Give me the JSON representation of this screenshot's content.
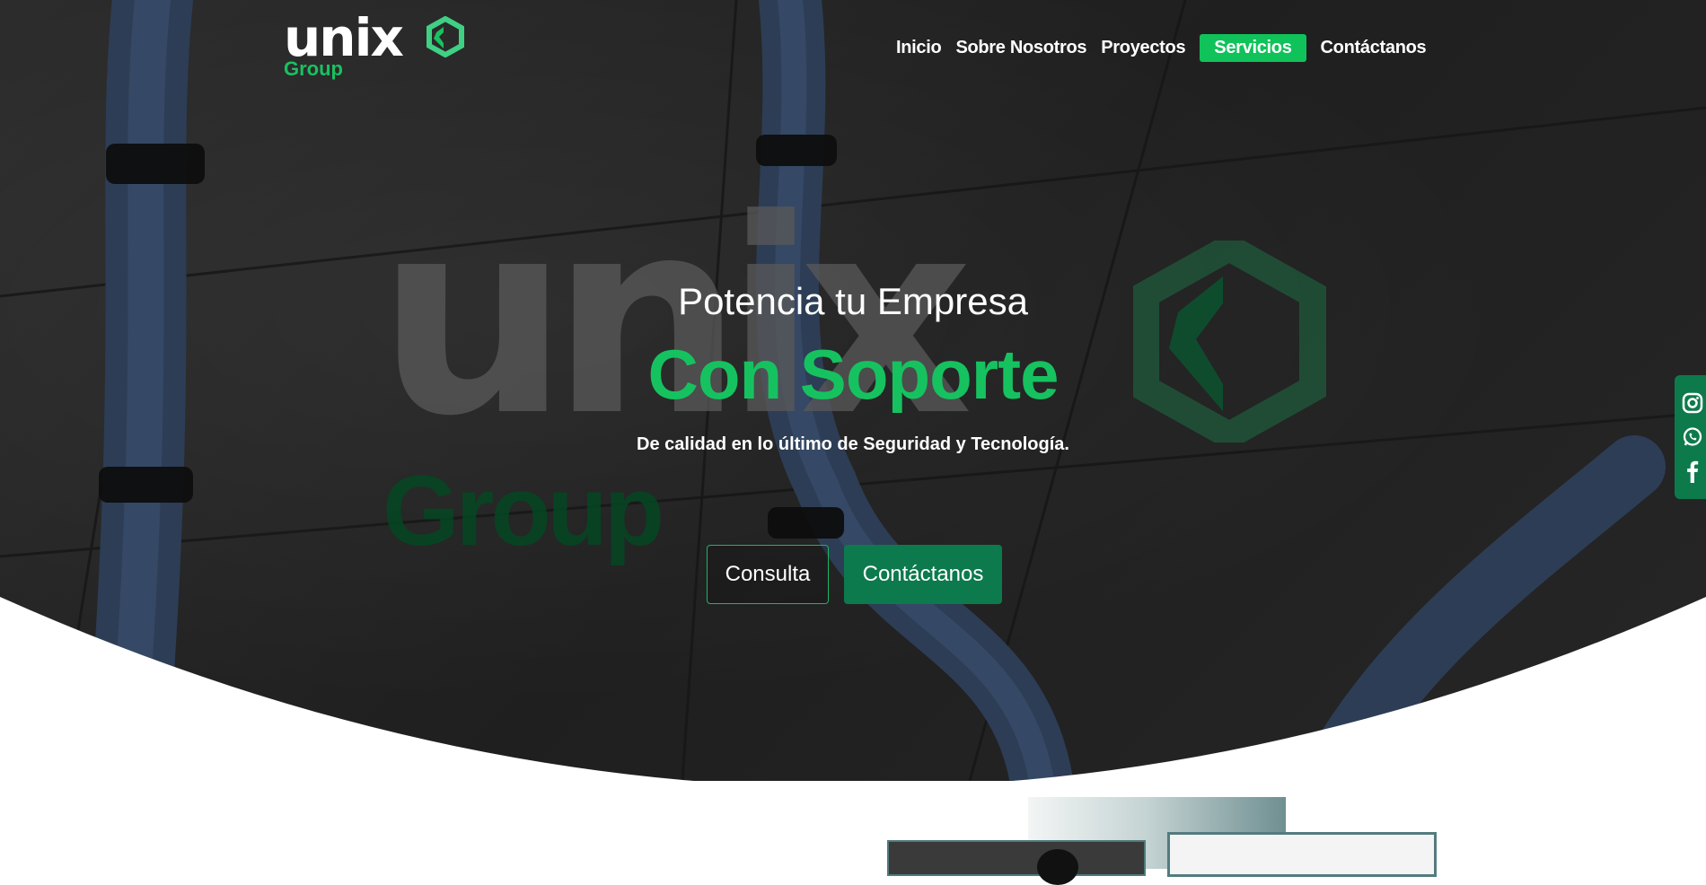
{
  "brand": {
    "name": "unix",
    "sub": "Group",
    "accent_color": "#19c160"
  },
  "nav": {
    "items": [
      {
        "label": "Inicio",
        "active": false
      },
      {
        "label": "Sobre Nosotros",
        "active": false
      },
      {
        "label": "Proyectos",
        "active": false
      },
      {
        "label": "Servicios",
        "active": true
      },
      {
        "label": "Contáctanos",
        "active": false
      }
    ]
  },
  "hero": {
    "watermark_word": "unix",
    "watermark_sub": "Group",
    "title": "Potencia tu Empresa",
    "highlight": "Con Soporte",
    "subtitle": "De calidad en lo último de Seguridad y Tecnología.",
    "buttons": {
      "consult": "Consulta",
      "contact": "Contáctanos"
    }
  },
  "social": {
    "icons": [
      "instagram-icon",
      "whatsapp-icon",
      "facebook-icon"
    ],
    "bar_color": "#0d7a4c"
  }
}
